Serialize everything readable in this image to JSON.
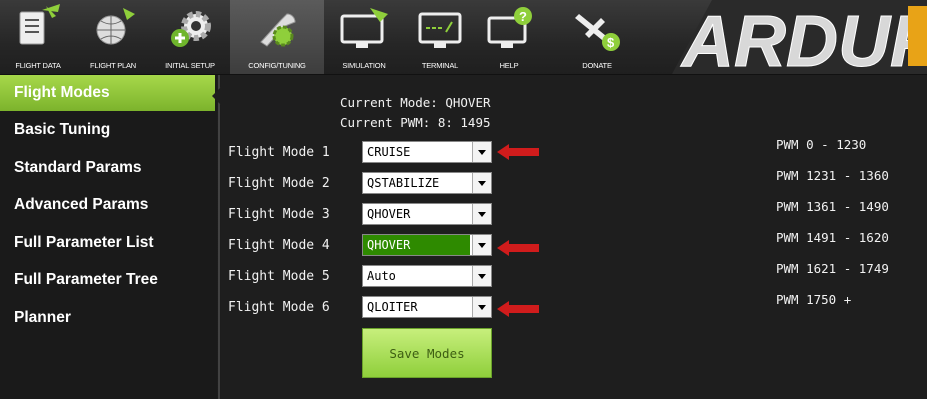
{
  "toolbar": {
    "buttons": [
      {
        "label": "FLIGHT DATA",
        "icon": "flight-data-icon"
      },
      {
        "label": "FLIGHT PLAN",
        "icon": "flight-plan-icon"
      },
      {
        "label": "INITIAL SETUP",
        "icon": "initial-setup-icon"
      },
      {
        "label": "CONFIG/TUNING",
        "icon": "config-tuning-icon"
      },
      {
        "label": "SIMULATION",
        "icon": "simulation-icon"
      },
      {
        "label": "TERMINAL",
        "icon": "terminal-icon"
      },
      {
        "label": "HELP",
        "icon": "help-icon"
      },
      {
        "label": "DONATE",
        "icon": "donate-icon"
      }
    ],
    "logo_text": "ARDUP",
    "active": "CONFIG/TUNING"
  },
  "sidebar": {
    "items": [
      {
        "label": "Flight Modes",
        "active": true
      },
      {
        "label": "Basic Tuning"
      },
      {
        "label": "Standard Params"
      },
      {
        "label": "Advanced Params"
      },
      {
        "label": "Full Parameter List"
      },
      {
        "label": "Full Parameter Tree"
      },
      {
        "label": "Planner"
      }
    ]
  },
  "status": {
    "current_mode": "Current Mode: QHOVER",
    "current_pwm": "Current PWM:  8: 1495"
  },
  "modes": [
    {
      "label": "Flight Mode 1",
      "value": "CRUISE",
      "pwm": "PWM 0 - 1230",
      "marked": true
    },
    {
      "label": "Flight Mode 2",
      "value": "QSTABILIZE",
      "pwm": "PWM 1231 - 1360"
    },
    {
      "label": "Flight Mode 3",
      "value": "QHOVER",
      "pwm": "PWM 1361 - 1490"
    },
    {
      "label": "Flight Mode 4",
      "value": "QHOVER",
      "pwm": "PWM 1491 - 1620",
      "highlighted": true,
      "marked": true
    },
    {
      "label": "Flight Mode 5",
      "value": "Auto",
      "pwm": "PWM 1621 - 1749"
    },
    {
      "label": "Flight Mode 6",
      "value": "QLOITER",
      "pwm": "PWM 1750 +",
      "marked": true
    }
  ],
  "save_button": "Save Modes",
  "colors": {
    "accent_green": "#8fcf3b",
    "selected_mode": "#2e8a00",
    "annotation_red": "#d01c1c"
  }
}
